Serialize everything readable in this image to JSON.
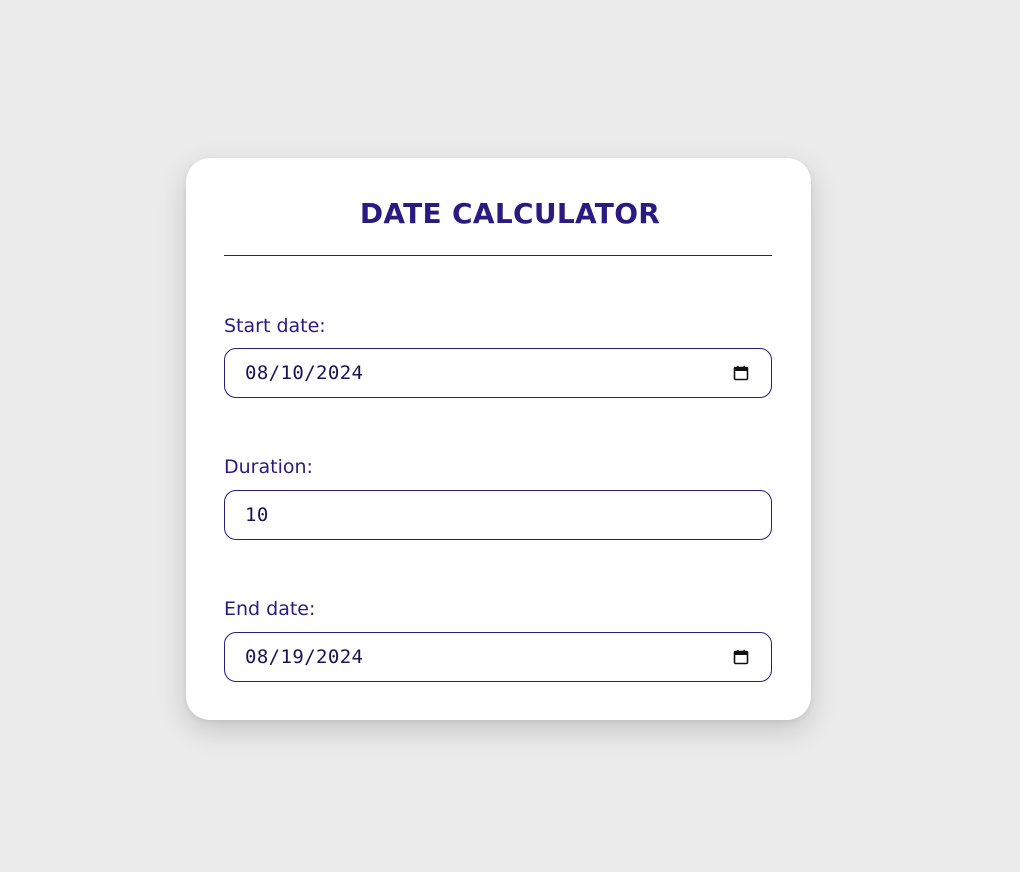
{
  "app": {
    "title": "DATE CALCULATOR"
  },
  "form": {
    "start_date": {
      "label": "Start date:",
      "value": "08/10/2024",
      "icon": "calendar-icon"
    },
    "duration": {
      "label": "Duration:",
      "value": "10"
    },
    "end_date": {
      "label": "End date:",
      "value": "08/19/2024",
      "icon": "calendar-icon"
    }
  },
  "colors": {
    "accent": "#2b1a7f",
    "background": "#ebebeb",
    "card": "#ffffff"
  }
}
